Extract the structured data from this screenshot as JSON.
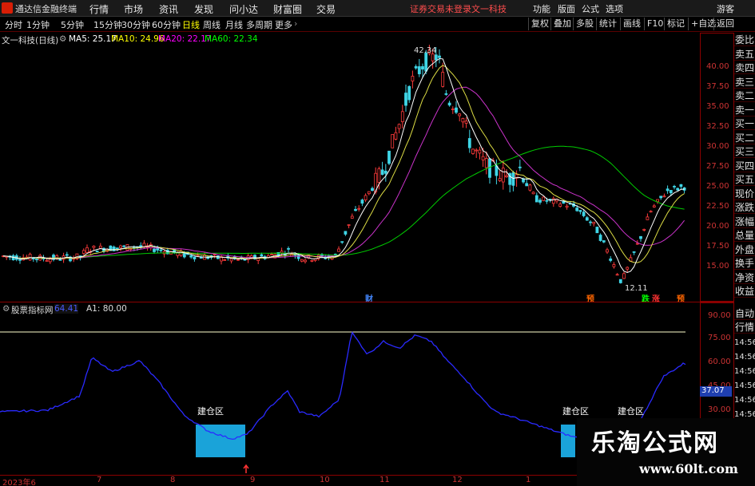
{
  "menubar": {
    "app_title": "通达信金融终端",
    "items": [
      "行情",
      "市场",
      "资讯",
      "发现",
      "问小达",
      "财富圈",
      "交易"
    ],
    "notice": "证券交易未登录",
    "stock_name": "文一科技",
    "right_items": [
      "功能",
      "版面",
      "公式",
      "选项"
    ],
    "guest": "游客"
  },
  "toolbar": {
    "periods": [
      "分时",
      "1分钟",
      "5分钟",
      "15分钟",
      "30分钟",
      "60分钟",
      "日线",
      "周线",
      "月线",
      "多周期",
      "更多"
    ],
    "active_period": "日线",
    "right_buttons": [
      "复权",
      "叠加",
      "多股",
      "统计",
      "画线",
      "F10",
      "标记",
      "+自选",
      "返回"
    ]
  },
  "main_info": {
    "title": "文一科技(日线)",
    "ma5": "MA5: 25.17",
    "ma10": "MA10: 24.96",
    "ma20": "MA20: 22.17",
    "ma60": "MA60: 22.34",
    "colors": {
      "ma5": "#ffffff",
      "ma10": "#ffff00",
      "ma20": "#ff00ff",
      "ma60": "#00ff00"
    }
  },
  "price_axis": [
    "40.00",
    "37.50",
    "35.00",
    "32.50",
    "30.00",
    "27.50",
    "25.00",
    "22.50",
    "20.00",
    "17.50",
    "15.00"
  ],
  "high_label": "42.34",
  "low_label": "12.11",
  "signals": [
    {
      "text": "财",
      "color": "#4488ff"
    },
    {
      "text": "预",
      "color": "#ff6600"
    },
    {
      "text": "跌",
      "color": "#00ff00"
    },
    {
      "text": "涨",
      "color": "#ff3333"
    },
    {
      "text": "预",
      "color": "#ff6600"
    }
  ],
  "side_panel": [
    "委比",
    "卖五",
    "卖四",
    "卖三",
    "卖二",
    "卖一",
    "买一",
    "买二",
    "买三",
    "买四",
    "买五",
    "现价",
    "涨跌",
    "涨幅",
    "总量",
    "外盘",
    "换手",
    "净资",
    "收益"
  ],
  "side_panel2": [
    "自动",
    "行情"
  ],
  "time_items": [
    "14:56",
    "14:56",
    "14:56",
    "14:56",
    "14:56",
    "14:56",
    "14:56",
    "14:56"
  ],
  "indicator": {
    "title": "股票指标网",
    "value1": "64.41",
    "a1": "A1: 80.00",
    "axis": [
      "90.00",
      "75.00",
      "60.00",
      "45.00",
      "30.00"
    ],
    "current": "37.07",
    "zones": [
      "建仓区",
      "建仓区",
      "建仓区"
    ]
  },
  "date_axis": [
    "2023年6",
    "7",
    "8",
    "9",
    "10",
    "11",
    "12",
    "1"
  ],
  "watermark": {
    "title": "乐淘公式网",
    "url": "www.60lt.com"
  }
}
